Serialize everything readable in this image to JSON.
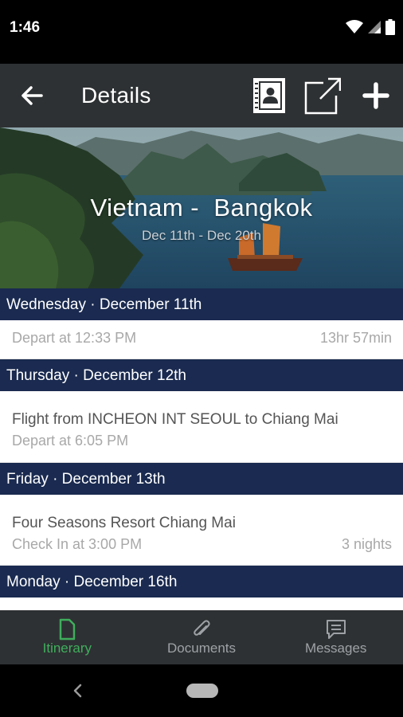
{
  "status_bar": {
    "time": "1:46",
    "icons": [
      "wifi-icon",
      "signal-icon",
      "battery-icon"
    ]
  },
  "app_bar": {
    "title": "Details",
    "icons": [
      "back-arrow-icon",
      "contacts-book-icon",
      "share-external-icon",
      "add-icon"
    ]
  },
  "hero": {
    "title": "Vietnam -  Bangkok",
    "dates": "Dec 11th - Dec 20th"
  },
  "itinerary": {
    "days": [
      {
        "header": "Wednesday · December 11th",
        "items": [
          {
            "title": "",
            "subtitle": "Depart at 12:33 PM",
            "right": "13hr 57min"
          }
        ]
      },
      {
        "header": "Thursday · December 12th",
        "items": [
          {
            "title": "Flight from INCHEON INT SEOUL to Chiang Mai",
            "subtitle": "Depart at 6:05 PM",
            "right": ""
          }
        ]
      },
      {
        "header": "Friday · December 13th",
        "items": [
          {
            "title": "Four Seasons Resort Chiang Mai",
            "subtitle": "Check In at 3:00 PM",
            "right": "3 nights"
          }
        ]
      },
      {
        "header": "Monday · December 16th",
        "items": []
      }
    ]
  },
  "bottom_nav": {
    "tabs": [
      {
        "label": "Itinerary",
        "icon": "document-icon",
        "active": true
      },
      {
        "label": "Documents",
        "icon": "paperclip-icon",
        "active": false
      },
      {
        "label": "Messages",
        "icon": "message-icon",
        "active": false
      }
    ]
  },
  "colors": {
    "app_bar": "#2e3133",
    "day_header": "#1a2a50",
    "accent_active": "#3fae5c",
    "nav_inactive": "#9ea2a6"
  }
}
